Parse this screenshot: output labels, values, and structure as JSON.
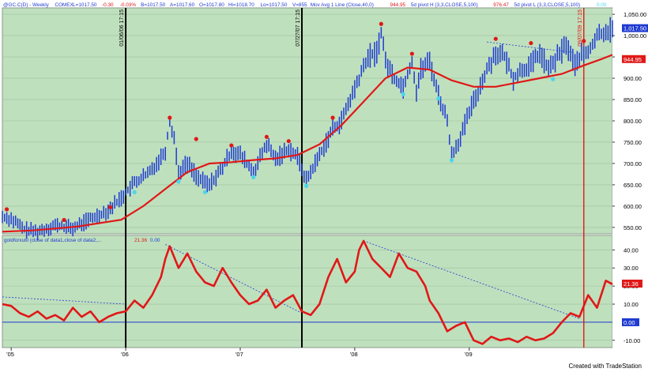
{
  "colors": {
    "panel_bg": "#bfe0bd",
    "bar": "#1f3bd1",
    "bar_up": "#1f3bd1",
    "ma": "#e01818",
    "osc": "#e01818",
    "pivot_high": "#e01818",
    "pivot_low": "#49d6ee",
    "zero_line": "#1f3bd1",
    "trend_dotted": "#1f3bd1",
    "vline_black": "#000000",
    "vline_red": "#e01818",
    "header_text": "#1f3bd1",
    "header_red": "#e01818"
  },
  "header": {
    "symbol": "@GC.C(D) - Weekly",
    "exchange": "COMEX",
    "last": "L=1017.50",
    "change": "-0.30",
    "pct": "-0.03%",
    "bid": "B=1017.50",
    "ask": "A=1017.60",
    "open": "O=1017.80",
    "high": "Hi=1018.70",
    "low": "Lo=1017.50",
    "volume": "V=855",
    "ma_label": "Mov Avg 1 Line (Close,40,0)",
    "ma_value": "944.95",
    "pivot_h_label": "5d pivot H (3,3,CLOSE,5,100)",
    "pivot_h_value": "976.47",
    "pivot_l_label": "5d pivot L (3,3,CLOSE,5,100)",
    "pivot_l_value": "0.00"
  },
  "lower_header": {
    "label": "goldforxutil (close of data1,close of data2,...",
    "value1": "21.36",
    "value2": "0.00"
  },
  "price_axis": {
    "ticks": [
      "1,050.00",
      "1,000.00",
      "950.00",
      "900.00",
      "850.00",
      "800.00",
      "750.00",
      "700.00",
      "650.00",
      "600.00",
      "550.00"
    ],
    "tick_values": [
      1050,
      1000,
      950,
      900,
      850,
      800,
      750,
      700,
      650,
      600,
      550
    ],
    "range": [
      535,
      1065
    ],
    "last_tag": "1,017.50",
    "ma_tag": "944.95"
  },
  "osc_axis": {
    "ticks": [
      "40.00",
      "30.00",
      "20.00",
      "10.00",
      "-10.00"
    ],
    "tick_values": [
      40,
      30,
      20,
      10,
      -10
    ],
    "range": [
      -14,
      48
    ],
    "last_tag": "21.36",
    "zero_tag": "0.00"
  },
  "time_axis": {
    "labels": [
      "'05",
      "'06",
      "'07",
      "'08",
      "'09"
    ],
    "label_weeks": [
      0,
      52,
      104,
      156,
      208
    ]
  },
  "vertical_lines": [
    {
      "week": 52,
      "label": "01/06/06 17:15",
      "color": "black"
    },
    {
      "week": 132,
      "label": "07/27/07 17:15",
      "color": "black"
    },
    {
      "week": 260,
      "label": "09/07/09 17:15",
      "color": "red"
    }
  ],
  "footer": {
    "credit": "Created with TradeStation"
  },
  "chart_data": {
    "type": "line",
    "x_unit": "weeks since start of 2005",
    "series": [
      {
        "kind": "price",
        "weeks": [
          -4,
          0,
          6,
          12,
          20,
          28,
          36,
          44,
          50,
          56,
          62,
          66,
          70,
          72,
          74,
          76,
          80,
          86,
          90,
          96,
          100,
          104,
          110,
          116,
          120,
          126,
          130,
          134,
          140,
          146,
          150,
          154,
          158,
          162,
          166,
          168,
          170,
          174,
          178,
          182,
          184,
          186,
          190,
          194,
          198,
          200,
          204,
          208,
          212,
          216,
          220,
          224,
          228,
          232,
          236,
          240,
          244,
          248,
          252,
          256,
          258,
          262,
          266,
          270,
          273
        ],
        "values": [
          575,
          570,
          545,
          540,
          555,
          548,
          570,
          590,
          620,
          655,
          675,
          700,
          730,
          800,
          760,
          680,
          700,
          660,
          650,
          690,
          730,
          720,
          680,
          745,
          710,
          735,
          715,
          660,
          720,
          780,
          800,
          850,
          900,
          950,
          960,
          1010,
          940,
          900,
          880,
          940,
          870,
          920,
          940,
          860,
          800,
          720,
          760,
          820,
          870,
          920,
          960,
          950,
          900,
          920,
          930,
          960,
          920,
          950,
          980,
          930,
          950,
          960,
          1000,
          1010,
          1017
        ]
      },
      {
        "kind": "ma40",
        "weeks": [
          -4,
          10,
          30,
          50,
          60,
          70,
          80,
          90,
          100,
          110,
          120,
          130,
          140,
          150,
          160,
          170,
          180,
          190,
          200,
          210,
          220,
          230,
          240,
          250,
          260,
          268,
          273
        ],
        "values": [
          540,
          543,
          552,
          568,
          600,
          640,
          680,
          700,
          703,
          708,
          712,
          720,
          745,
          790,
          845,
          900,
          925,
          920,
          895,
          880,
          880,
          890,
          900,
          910,
          930,
          945,
          955
        ]
      },
      {
        "kind": "oscillator",
        "weeks": [
          -4,
          0,
          4,
          8,
          12,
          16,
          20,
          24,
          28,
          32,
          36,
          40,
          44,
          48,
          52,
          56,
          60,
          64,
          68,
          70,
          72,
          76,
          80,
          84,
          88,
          92,
          96,
          100,
          104,
          108,
          112,
          116,
          120,
          124,
          128,
          132,
          136,
          140,
          144,
          148,
          152,
          156,
          158,
          160,
          164,
          168,
          172,
          176,
          180,
          184,
          188,
          190,
          194,
          198,
          202,
          206,
          210,
          214,
          218,
          222,
          226,
          230,
          234,
          238,
          242,
          246,
          250,
          254,
          258,
          262,
          266,
          270,
          273
        ],
        "values": [
          10,
          9,
          5,
          3,
          6,
          2,
          4,
          1,
          8,
          3,
          6,
          0,
          3,
          5,
          6,
          12,
          8,
          15,
          25,
          35,
          42,
          30,
          38,
          28,
          22,
          20,
          30,
          22,
          15,
          10,
          12,
          18,
          8,
          12,
          15,
          6,
          4,
          10,
          25,
          35,
          22,
          28,
          40,
          45,
          35,
          30,
          25,
          38,
          30,
          28,
          20,
          12,
          5,
          -5,
          -2,
          0,
          -10,
          -12,
          -8,
          -10,
          -9,
          -11,
          -8,
          -10,
          -9,
          -6,
          0,
          5,
          3,
          15,
          8,
          23,
          21
        ]
      }
    ],
    "pivot_highs": [
      {
        "week": -2,
        "value": 585
      },
      {
        "week": 24,
        "value": 560
      },
      {
        "week": 45,
        "value": 590
      },
      {
        "week": 72,
        "value": 800
      },
      {
        "week": 84,
        "value": 750
      },
      {
        "week": 100,
        "value": 735
      },
      {
        "week": 116,
        "value": 755
      },
      {
        "week": 126,
        "value": 745
      },
      {
        "week": 146,
        "value": 800
      },
      {
        "week": 168,
        "value": 1020
      },
      {
        "week": 182,
        "value": 950
      },
      {
        "week": 220,
        "value": 985
      },
      {
        "week": 236,
        "value": 975
      },
      {
        "week": 260,
        "value": 980
      }
    ],
    "pivot_lows": [
      {
        "week": 56,
        "value": 640
      },
      {
        "week": 76,
        "value": 665
      },
      {
        "week": 88,
        "value": 640
      },
      {
        "week": 110,
        "value": 675
      },
      {
        "week": 134,
        "value": 655
      },
      {
        "week": 178,
        "value": 870
      },
      {
        "week": 194,
        "value": 860
      },
      {
        "week": 200,
        "value": 715
      },
      {
        "week": 246,
        "value": 905
      }
    ],
    "price_trendlines": [
      {
        "from_week": 216,
        "from_value": 985,
        "to_week": 256,
        "to_value": 960
      }
    ],
    "osc_trendlines": [
      {
        "from_week": -4,
        "from_value": 14,
        "to_week": 52,
        "to_value": 10
      },
      {
        "from_week": 70,
        "from_value": 43,
        "to_week": 132,
        "to_value": 5
      },
      {
        "from_week": 160,
        "from_value": 45,
        "to_week": 258,
        "to_value": 2
      }
    ]
  }
}
